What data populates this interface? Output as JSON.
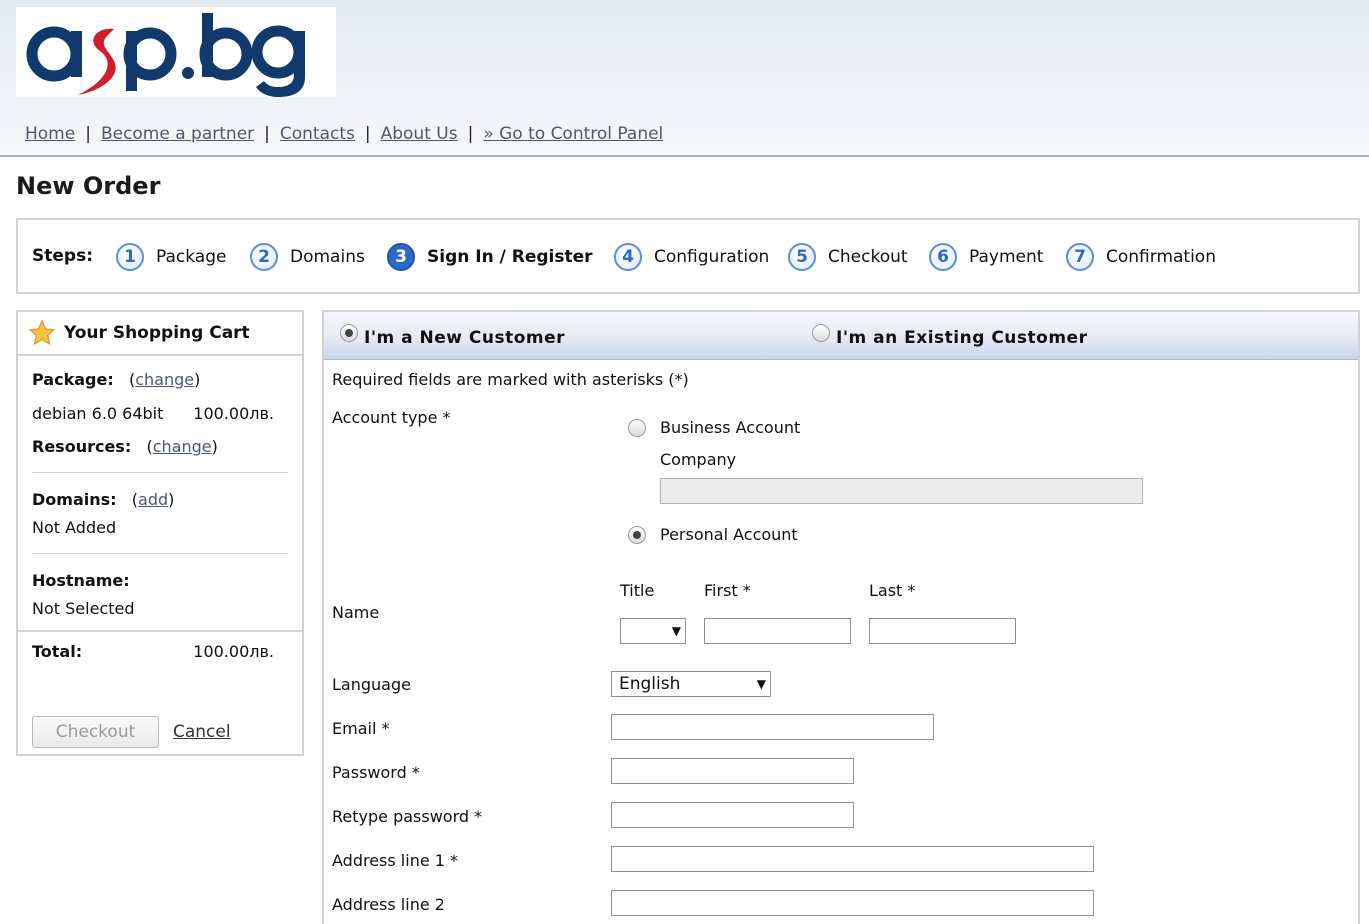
{
  "header": {
    "logo_text": "asp.bg",
    "nav": [
      "Home",
      "Become a partner",
      "Contacts",
      "About Us",
      "» Go to Control Panel"
    ],
    "nav_sep": "|"
  },
  "page_title": "New Order",
  "steps": {
    "label": "Steps:",
    "items": [
      {
        "num": "1",
        "label": "Package"
      },
      {
        "num": "2",
        "label": "Domains"
      },
      {
        "num": "3",
        "label": "Sign In / Register",
        "active": true
      },
      {
        "num": "4",
        "label": "Configuration"
      },
      {
        "num": "5",
        "label": "Checkout"
      },
      {
        "num": "6",
        "label": "Payment"
      },
      {
        "num": "7",
        "label": "Confirmation"
      }
    ]
  },
  "cart": {
    "title": "Your Shopping Cart",
    "package_label": "Package:",
    "package_change": "change",
    "package_name": "debian 6.0 64bit",
    "package_price": "100.00лв.",
    "resources_label": "Resources:",
    "resources_change": "change",
    "domains_label": "Domains:",
    "domains_add": "add",
    "domains_value": "Not Added",
    "hostname_label": "Hostname:",
    "hostname_value": "Not Selected",
    "total_label": "Total:",
    "total_value": "100.00лв.",
    "checkout_label": "Checkout",
    "cancel_label": "Cancel"
  },
  "form": {
    "tab_new": "I'm a New Customer",
    "tab_existing": "I'm an Existing Customer",
    "required_note": "Required fields are marked with asterisks (*)",
    "account_type_label": "Account type *",
    "business_account": "Business Account",
    "company_label": "Company",
    "personal_account": "Personal Account",
    "name_label": "Name",
    "title_label": "Title",
    "first_label": "First *",
    "last_label": "Last *",
    "language_label": "Language",
    "language_value": "English",
    "email_label": "Email *",
    "password_label": "Password *",
    "retype_label": "Retype password *",
    "address1_label": "Address line 1 *",
    "address2_label": "Address line 2"
  }
}
